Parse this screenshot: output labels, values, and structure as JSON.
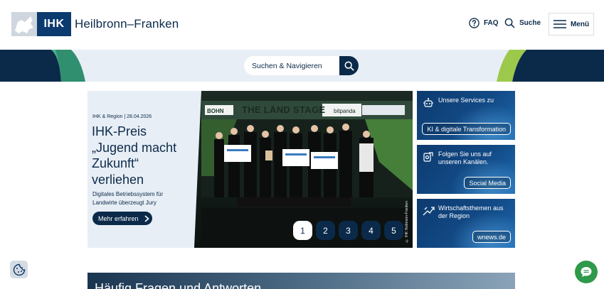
{
  "header": {
    "logo_box": "IHK",
    "logo_text": "Heilbronn–Franken",
    "faq_label": "FAQ",
    "search_label": "Suche",
    "menu_label": "Menü"
  },
  "search": {
    "placeholder": "Suchen & Navigieren"
  },
  "hero": {
    "meta": "IHK & Region | 28.04.2026",
    "title": "IHK-Preis „Jugend macht Zukunft“ verliehen",
    "subtitle": "Digitales Betriebssystem für Landwirte überzeugt Jury",
    "cta_label": "Mehr erfahren",
    "photo_credit": "© IHK Heilbronn-Franken",
    "stage_text": "THE LÄND STAGE",
    "sponsor_left": "BOHN",
    "sponsor_right": "bitpanda",
    "pages": [
      "1",
      "2",
      "3",
      "4",
      "5"
    ],
    "active_page": 0
  },
  "cards": [
    {
      "title": "Unsere Services zu",
      "button": "KI & digitale Transformation",
      "icon": "ai-robot-icon"
    },
    {
      "title": "Folgen Sie uns auf unseren Kanälen.",
      "button": "Social Media",
      "icon": "social-share-icon"
    },
    {
      "title": "Wirtschaftsthemen aus der Region",
      "button": "wnews.de",
      "icon": "news-icon"
    }
  ],
  "bottom": {
    "text": "Häufig Fragen und Antworten"
  },
  "colors": {
    "navy": "#0b2a4a",
    "band": "#e8eef5",
    "green": "#2e9a4a"
  }
}
